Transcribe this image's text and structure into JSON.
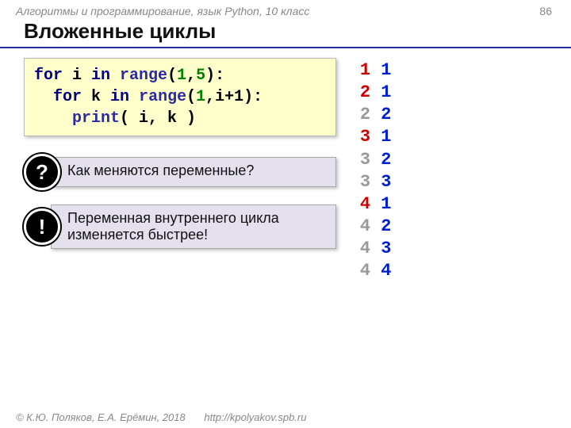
{
  "header": {
    "breadcrumb": "Алгоритмы и программирование, язык Python, 10 класс",
    "page_number": "86",
    "title": "Вложенные циклы"
  },
  "code": {
    "line1": {
      "kw1": "for",
      "var": " i ",
      "kw2": "in",
      "fn": " range",
      "open": "(",
      "n1": "1",
      "comma": ",",
      "n2": "5",
      "close": "):"
    },
    "line2": {
      "indent": "  ",
      "kw1": "for",
      "var": " k ",
      "kw2": "in",
      "fn": " range",
      "open": "(",
      "n1": "1",
      "rest": ",i+1):"
    },
    "line3": {
      "indent": "    ",
      "fn": "print",
      "args": "( i, k )"
    }
  },
  "callouts": {
    "question_mark": "?",
    "question_text": "Как меняются переменные?",
    "exclaim_mark": "!",
    "exclaim_text": "Переменная внутреннего цикла изменяется быстрее!"
  },
  "output": [
    {
      "i": "1",
      "k": "1",
      "i_grey": false,
      "k_grey": false
    },
    {
      "i": "2",
      "k": "1",
      "i_grey": false,
      "k_grey": false
    },
    {
      "i": "2",
      "k": "2",
      "i_grey": true,
      "k_grey": false
    },
    {
      "i": "3",
      "k": "1",
      "i_grey": false,
      "k_grey": false
    },
    {
      "i": "3",
      "k": "2",
      "i_grey": true,
      "k_grey": false
    },
    {
      "i": "3",
      "k": "3",
      "i_grey": true,
      "k_grey": false
    },
    {
      "i": "4",
      "k": "1",
      "i_grey": false,
      "k_grey": false
    },
    {
      "i": "4",
      "k": "2",
      "i_grey": true,
      "k_grey": false
    },
    {
      "i": "4",
      "k": "3",
      "i_grey": true,
      "k_grey": false
    },
    {
      "i": "4",
      "k": "4",
      "i_grey": true,
      "k_grey": false
    }
  ],
  "footer": {
    "copyright": "© К.Ю. Поляков, Е.А. Ерёмин, 2018",
    "url": "http://kpolyakov.spb.ru"
  }
}
